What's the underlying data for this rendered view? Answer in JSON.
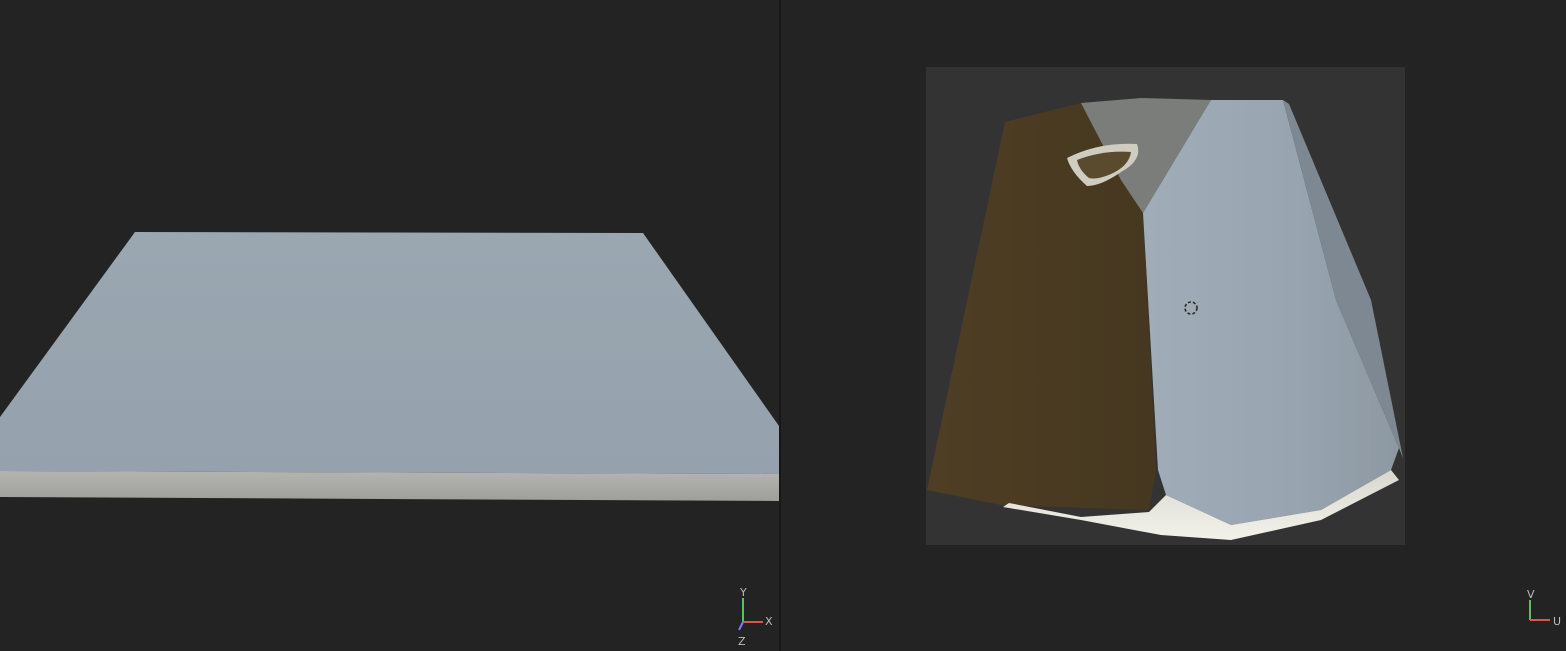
{
  "viewport_3d": {
    "gizmo_axes": {
      "y": "Y",
      "x": "X",
      "z": "Z"
    },
    "colors": {
      "y_axis": "#5fbf5f",
      "x_axis": "#d9534f",
      "z_axis": "#7a7aff"
    }
  },
  "viewport_uv": {
    "gizmo_axes": {
      "v": "V",
      "u": "U"
    },
    "colors": {
      "v_axis": "#5fbf5f",
      "u_axis": "#d9534f"
    }
  },
  "colors": {
    "background": "#232323",
    "mesh_top": "#98a4af",
    "mesh_side": "#a9aaa6",
    "uv_tile": "#333333",
    "texture_brown": "#4a3a22"
  },
  "icons": {
    "cursor": "uv-cursor-icon",
    "gizmo_3d": "axis-gizmo-icon",
    "gizmo_uv": "uv-axis-gizmo-icon"
  }
}
